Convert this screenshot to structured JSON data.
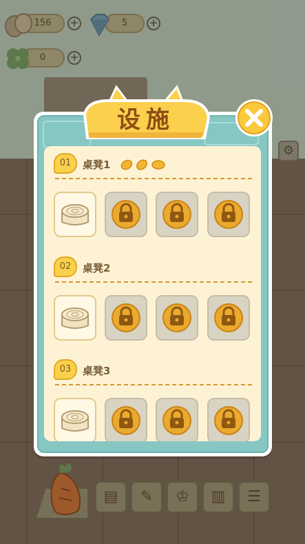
{
  "resources": {
    "beans": {
      "value": "156",
      "icon": "bean-icon"
    },
    "gems": {
      "value": "5",
      "icon": "diamond-icon"
    },
    "clover": {
      "value": "0",
      "icon": "clover-icon"
    }
  },
  "dialog": {
    "title": "设施",
    "close_icon": "close-icon"
  },
  "sections": [
    {
      "badge": "01",
      "title": "桌凳1",
      "seed_count": 3,
      "slots": [
        "unlocked",
        "locked",
        "locked",
        "locked"
      ]
    },
    {
      "badge": "02",
      "title": "桌凳2",
      "slots": [
        "unlocked",
        "locked",
        "locked",
        "locked"
      ]
    },
    {
      "badge": "03",
      "title": "桌凳3",
      "slots": [
        "unlocked",
        "locked",
        "locked",
        "locked"
      ]
    }
  ],
  "bottom_bar": {
    "items": [
      "carrot-icon",
      "cabinet-icon",
      "clipboard-icon",
      "trophy-icon",
      "book-icon",
      "newspaper-icon"
    ]
  },
  "settings_icon": "gear-icon",
  "colors": {
    "banner": "#fbd04c",
    "dialog_teal": "#86c7c4",
    "panel": "#fdf3d4",
    "lock": "#e7a82e"
  }
}
